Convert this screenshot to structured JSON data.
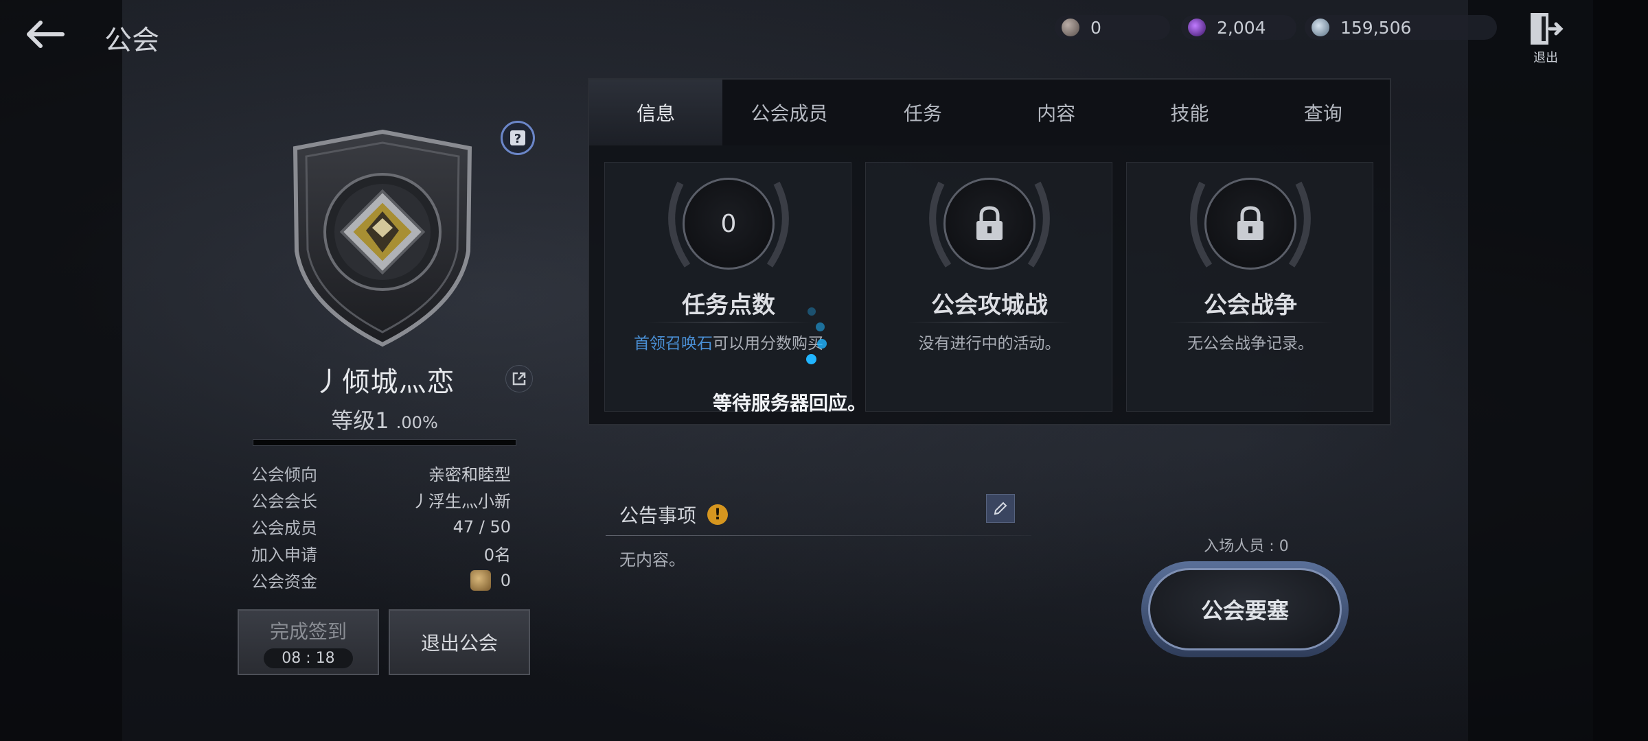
{
  "header": {
    "title": "公会",
    "exit_label": "退出"
  },
  "currencies": [
    {
      "icon": "orb-icon",
      "value": "0",
      "color": "#8c7f78"
    },
    {
      "icon": "purple-gem-icon",
      "value": "2,004",
      "color": "#7a3fc0"
    },
    {
      "icon": "silver-coin-icon",
      "value": "159,506",
      "color": "#8fa4b8"
    }
  ],
  "guild": {
    "name": "丿倾城灬恋",
    "level_label": "等级1",
    "level_percent_text": ".00%",
    "level_progress": 0.0,
    "stats": [
      {
        "key": "公会倾向",
        "value": "亲密和睦型"
      },
      {
        "key": "公会会长",
        "value": "丿浮生灬小新"
      },
      {
        "key": "公会成员",
        "value": "47 / 50"
      },
      {
        "key": "加入申请",
        "value": "0名"
      },
      {
        "key": "公会资金",
        "value": "0"
      }
    ],
    "checkin_label": "完成签到",
    "checkin_timer": "08 : 18",
    "leave_label": "退出公会"
  },
  "tabs": [
    "信息",
    "公会成员",
    "任务",
    "内容",
    "技能",
    "查询"
  ],
  "active_tab": 0,
  "cards": [
    {
      "medal": "0",
      "title": "任务点数",
      "desc_highlight": "首领召唤石",
      "desc": "可以用分数购买"
    },
    {
      "medal": "",
      "title": "公会攻城战",
      "desc_highlight": "",
      "desc": "没有进行中的活动。"
    },
    {
      "medal": "",
      "title": "公会战争",
      "desc_highlight": "",
      "desc": "无公会战争记录。"
    }
  ],
  "loading_text": "等待服务器回应。",
  "notice": {
    "title": "公告事项",
    "warn": "!",
    "body": "无内容。"
  },
  "fortress": {
    "entry_label": "入场人员 : 0",
    "button_label": "公会要塞"
  },
  "colors": {
    "accent_blue": "#21b5ff",
    "highlight_text": "#4a90d6",
    "warning": "#d6961f"
  }
}
